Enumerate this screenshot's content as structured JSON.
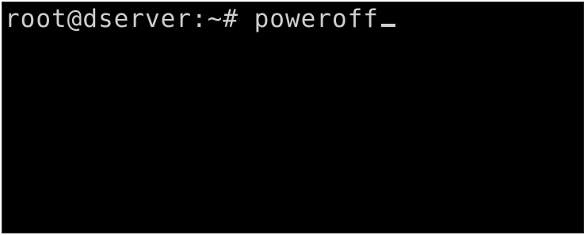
{
  "terminal": {
    "prompt": "root@dserver:~# ",
    "command": "poweroff"
  },
  "colors": {
    "background": "#000000",
    "foreground": "#cfcfcf"
  }
}
